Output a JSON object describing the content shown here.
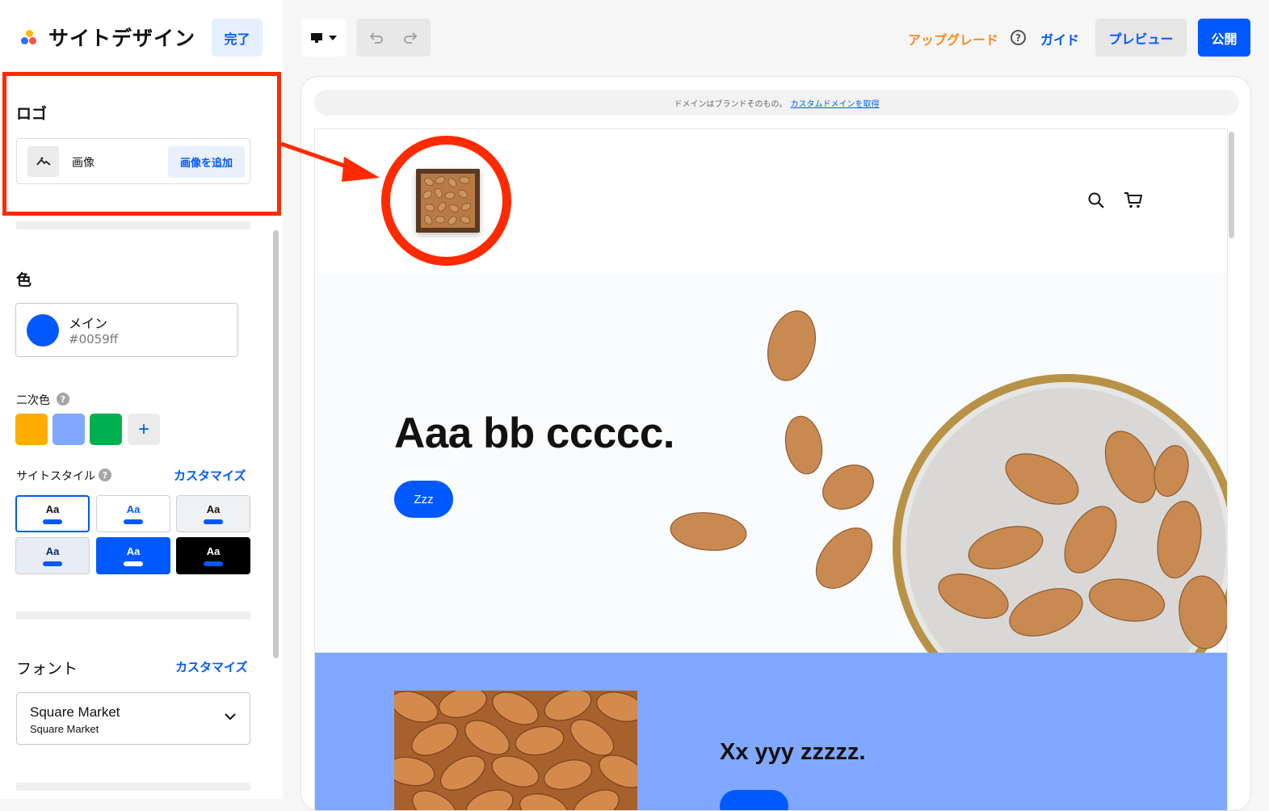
{
  "app": {
    "title": "サイトデザイン",
    "done_label": "完了"
  },
  "toolbar": {
    "device_icon": "desktop-icon",
    "upgrade_label": "アップグレード",
    "guide_label": "ガイド",
    "preview_label": "プレビュー",
    "publish_label": "公開"
  },
  "logo_section": {
    "heading": "ロゴ",
    "image_label": "画像",
    "add_image_label": "画像を追加"
  },
  "color_section": {
    "heading": "色",
    "main_label": "メイン",
    "main_hex": "#0059ff",
    "main_color": "#0059ff",
    "secondary_label": "二次色",
    "secondary_colors": [
      "#ffad00",
      "#80a8ff",
      "#00b050"
    ],
    "add_color_label": "+"
  },
  "site_style": {
    "label": "サイトスタイル",
    "customize_label": "カスタマイズ",
    "tiles": [
      {
        "label": "Aa",
        "selected": true
      },
      {
        "label": "Aa",
        "selected": false
      },
      {
        "label": "Aa",
        "selected": false
      },
      {
        "label": "Aa",
        "selected": false
      },
      {
        "label": "Aa",
        "selected": false
      },
      {
        "label": "Aa",
        "selected": false
      }
    ]
  },
  "font_section": {
    "heading": "フォント",
    "customize_label": "カスタマイズ",
    "selected_font": "Square Market",
    "selected_font_sub": "Square Market"
  },
  "preview": {
    "domain_banner_text": "ドメインはブランドそのもの。",
    "domain_banner_link": "カスタムドメインを取得",
    "hero_heading": "Aaa bb ccccc.",
    "hero_button": "Zzz",
    "section2_heading": "Xx yyy zzzzz."
  }
}
